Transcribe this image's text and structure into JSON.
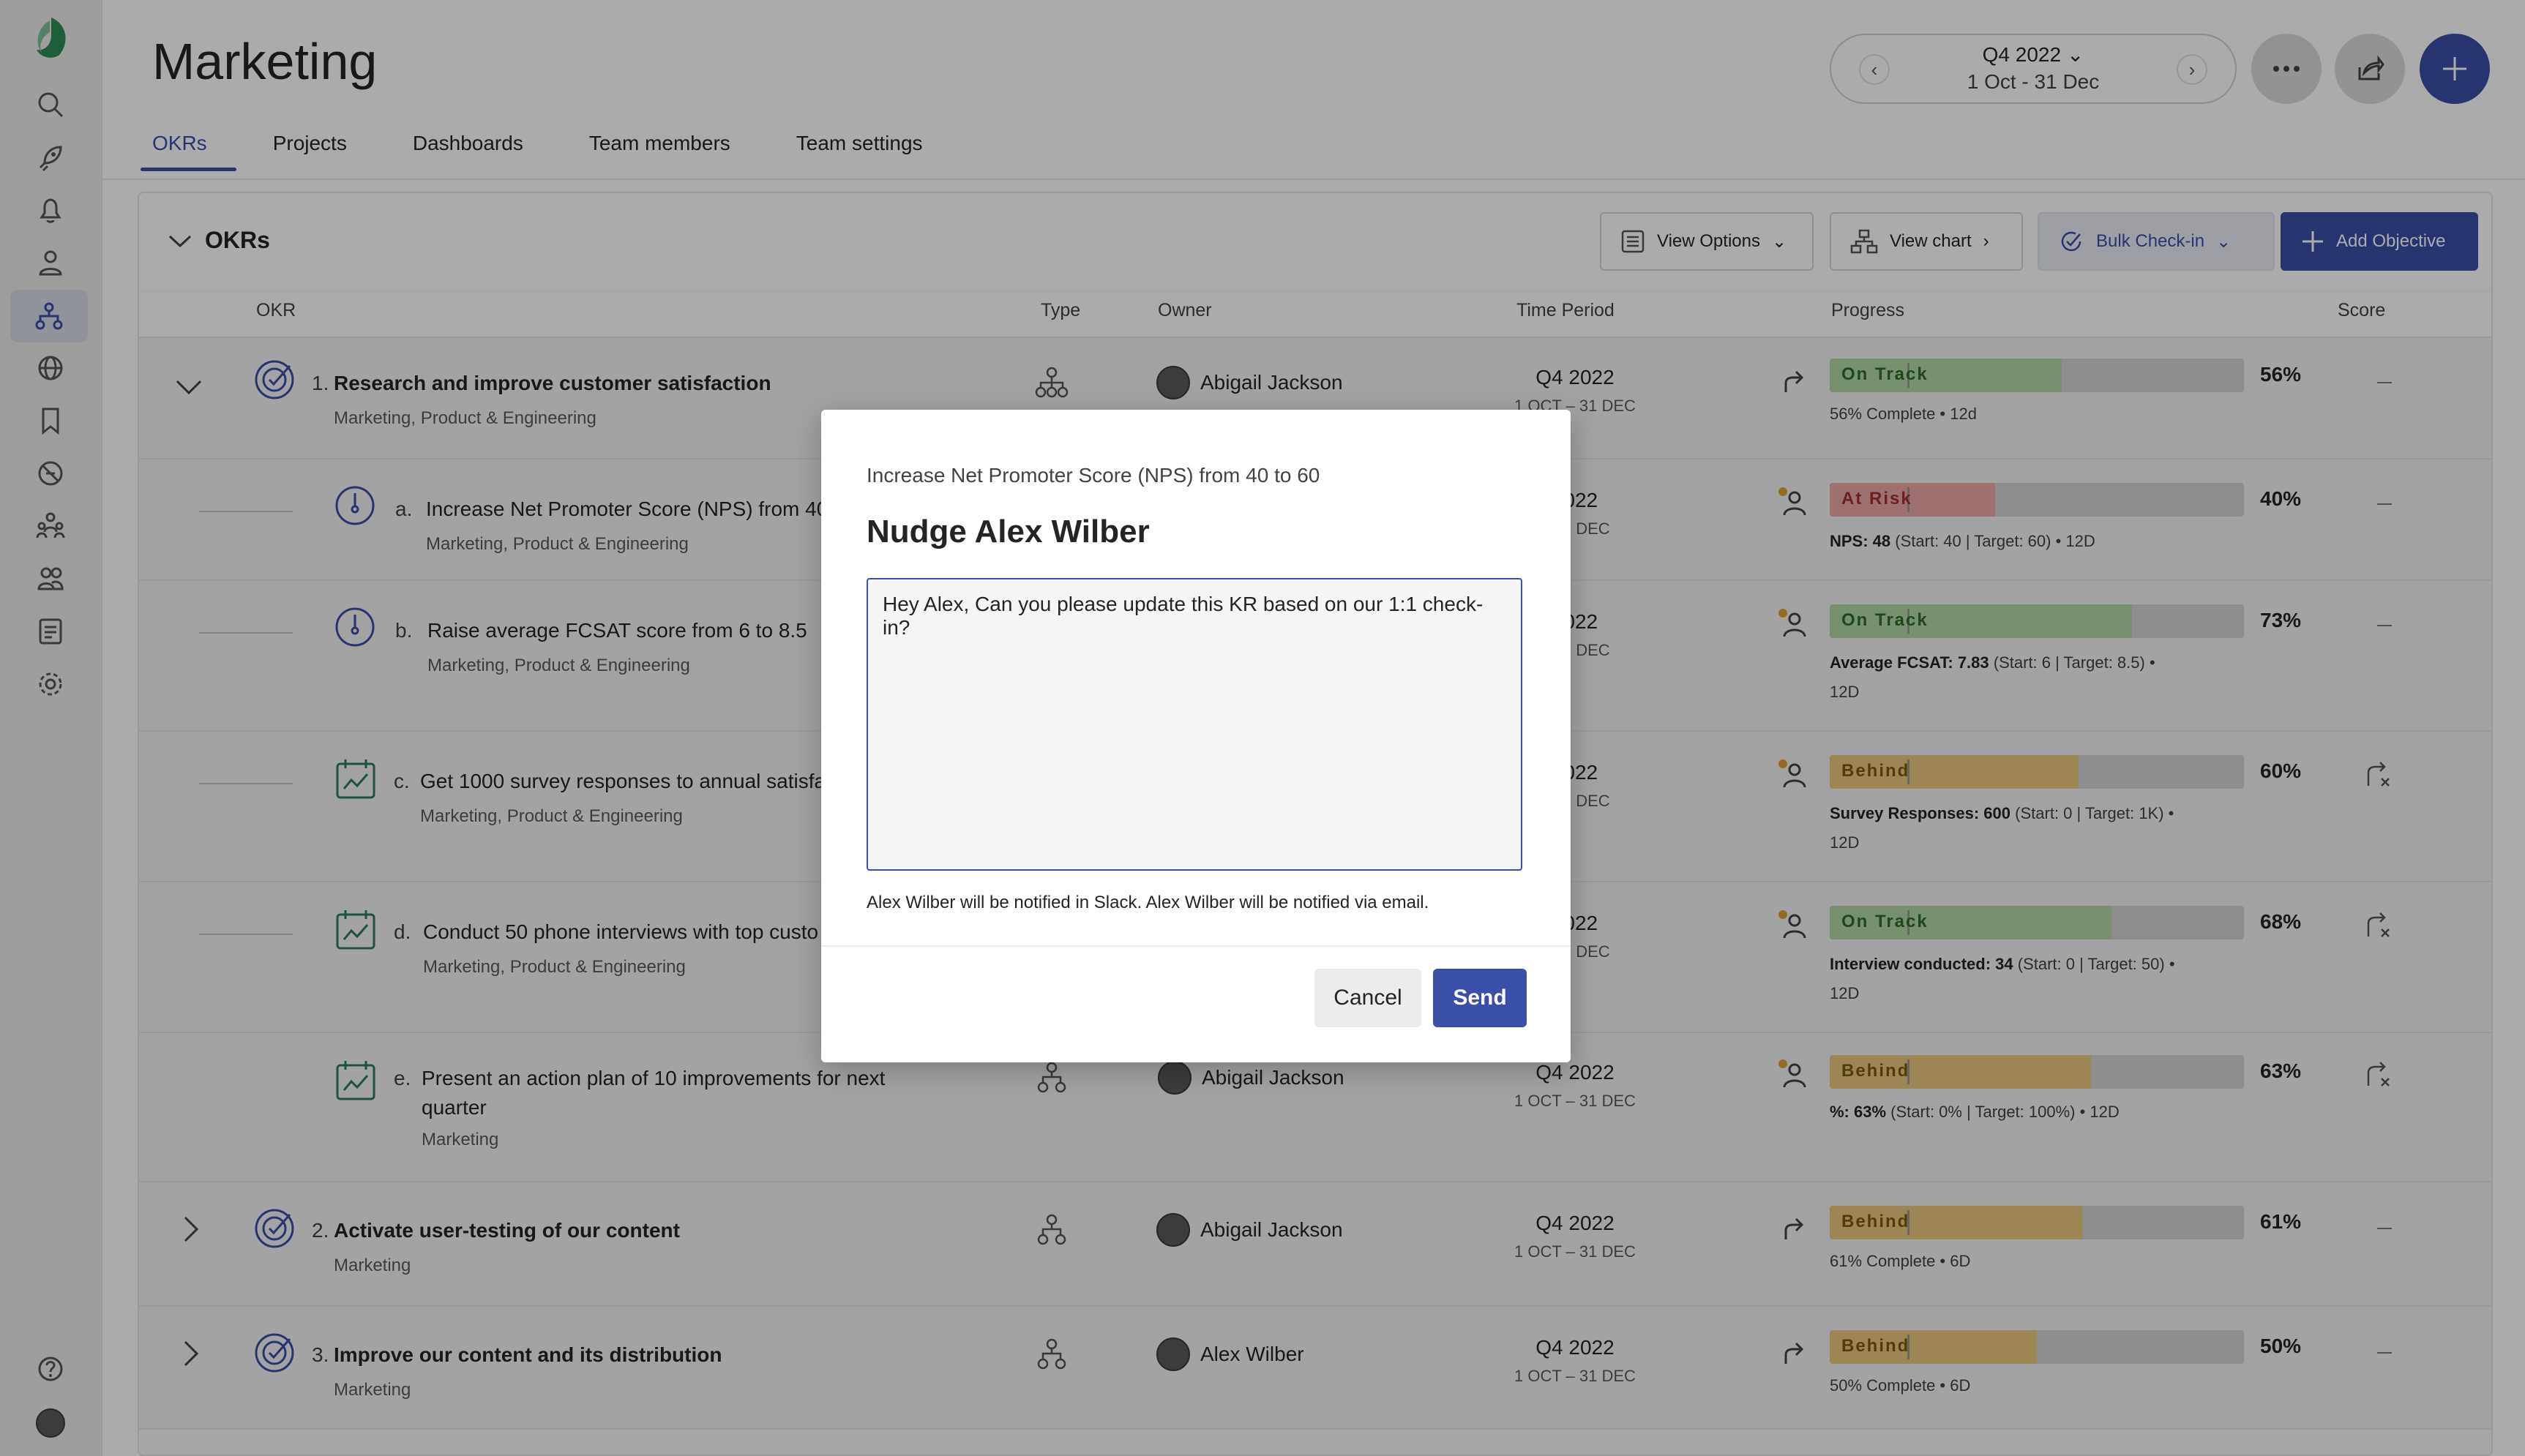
{
  "app": {
    "page_title": "Marketing",
    "tabs": [
      {
        "label": "OKRs",
        "active": true
      },
      {
        "label": "Projects"
      },
      {
        "label": "Dashboards"
      },
      {
        "label": "Team members"
      },
      {
        "label": "Team settings"
      }
    ],
    "period": {
      "label": "Q4 2022",
      "range": "1 Oct - 31 Dec"
    }
  },
  "rail_icons": [
    "app-logo-icon",
    "search-icon",
    "rocket-icon",
    "bell-icon",
    "person-icon",
    "org-chart-icon",
    "globe-icon",
    "bookmark-icon",
    "blocked-icon",
    "people-icon",
    "team-icon",
    "list-icon",
    "gear-icon",
    "help-icon",
    "user-avatar"
  ],
  "toolbar": {
    "section_title": "OKRs",
    "view_options": "View Options",
    "view_chart": "View chart",
    "bulk_checkin": "Bulk Check-in",
    "add_objective": "Add Objective"
  },
  "columns": {
    "okr": "OKR",
    "type": "Type",
    "owner": "Owner",
    "time_period": "Time Period",
    "progress": "Progress",
    "score": "Score"
  },
  "status_colors": {
    "on_track": "#b4d7a7",
    "at_risk": "#eda7a7",
    "behind": "#e8c87e"
  },
  "objectives": [
    {
      "num": "1.",
      "title": "Research and improve customer satisfaction",
      "team": "Marketing, Product & Engineering",
      "owner": "Abigail Jackson",
      "period": "Q4 2022",
      "period_range": "1 OCT – 31 DEC",
      "status": "On Track",
      "progress": 56,
      "pct": "56%",
      "detail": "56% Complete • 12d",
      "score": "—"
    },
    {
      "num": "2.",
      "title": "Activate user-testing of our content",
      "team": "Marketing",
      "owner": "Abigail Jackson",
      "period": "Q4 2022",
      "period_range": "1 OCT – 31 DEC",
      "status": "Behind",
      "progress": 61,
      "pct": "61%",
      "detail": "61% Complete • 6D",
      "score": "—"
    },
    {
      "num": "3.",
      "title": "Improve our content and its distribution",
      "team": "Marketing",
      "owner": "Alex Wilber",
      "period": "Q4 2022",
      "period_range": "1 OCT – 31 DEC",
      "status": "Behind",
      "progress": 50,
      "pct": "50%",
      "detail": "50% Complete • 6D",
      "score": "—"
    }
  ],
  "key_results": [
    {
      "letter": "a.",
      "title": "Increase Net Promoter Score (NPS) from 40",
      "team": "Marketing, Product & Engineering",
      "period": "2022",
      "period_range": "– 31 DEC",
      "status": "At Risk",
      "progress": 40,
      "pct": "40%",
      "metric": "NPS: 48",
      "detail": "(Start: 40 | Target: 60) • 12D",
      "score": "—"
    },
    {
      "letter": "b.",
      "title": "Raise average FCSAT score from 6 to 8.5",
      "team": "Marketing, Product & Engineering",
      "period": "2022",
      "period_range": "– 31 DEC",
      "status": "On Track",
      "progress": 73,
      "pct": "73%",
      "metric": "Average FCSAT: 7.83",
      "detail": "(Start: 6 | Target: 8.5) • 12D",
      "score": "—"
    },
    {
      "letter": "c.",
      "title": "Get 1000 survey responses to annual satisfac",
      "team": "Marketing, Product & Engineering",
      "period": "2022",
      "period_range": "– 31 DEC",
      "status": "Behind",
      "progress": 60,
      "pct": "60%",
      "metric": "Survey Responses: 600",
      "detail": "(Start: 0 | Target: 1K) • 12D"
    },
    {
      "letter": "d.",
      "title": "Conduct 50 phone interviews with top custo",
      "team": "Marketing, Product & Engineering",
      "period": "2022",
      "period_range": "– 31 DEC",
      "status": "On Track",
      "progress": 68,
      "pct": "68%",
      "metric": "Interview conducted: 34",
      "detail": "(Start: 0 | Target: 50) • 12D"
    },
    {
      "letter": "e.",
      "title": "Present an action plan of 10 improvements for next",
      "title2": "quarter",
      "team": "Marketing",
      "owner": "Abigail Jackson",
      "period": "Q4 2022",
      "period_range": "1 OCT – 31 DEC",
      "status": "Behind",
      "progress": 63,
      "pct": "63%",
      "metric": "%: 63%",
      "detail": "(Start: 0% | Target: 100%) • 12D"
    }
  ],
  "modal": {
    "kr_title": "Increase Net Promoter Score (NPS) from 40 to 60",
    "title": "Nudge Alex Wilber",
    "message": "Hey Alex, Can you please update this KR based on our 1:1 check-in?",
    "note": "Alex Wilber will be notified in Slack. Alex Wilber will be notified via email.",
    "cancel_label": "Cancel",
    "send_label": "Send"
  }
}
